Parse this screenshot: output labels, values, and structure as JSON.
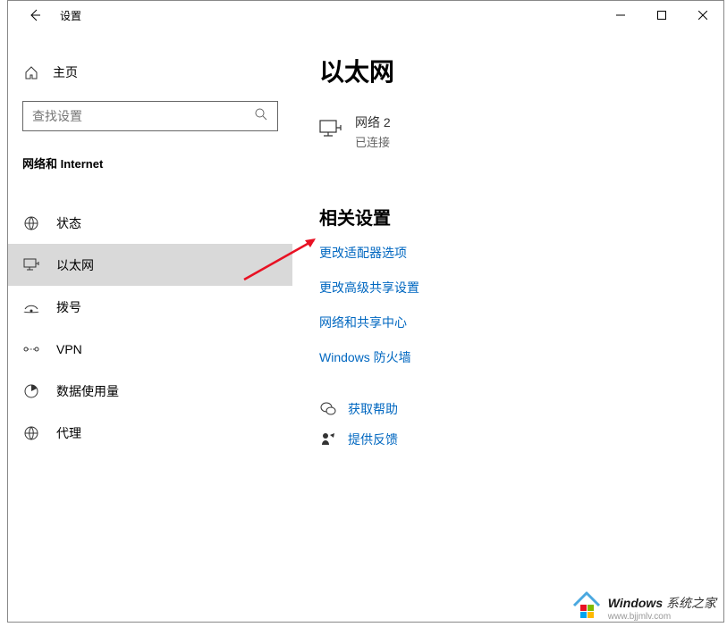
{
  "titlebar": {
    "title": "设置"
  },
  "sidebar": {
    "home_label": "主页",
    "search_placeholder": "查找设置",
    "section_header": "网络和 Internet",
    "items": [
      {
        "label": "状态"
      },
      {
        "label": "以太网"
      },
      {
        "label": "拨号"
      },
      {
        "label": "VPN"
      },
      {
        "label": "数据使用量"
      },
      {
        "label": "代理"
      }
    ]
  },
  "main": {
    "page_title": "以太网",
    "network": {
      "name": "网络 2",
      "status": "已连接"
    },
    "related": {
      "title": "相关设置",
      "links": [
        "更改适配器选项",
        "更改高级共享设置",
        "网络和共享中心",
        "Windows 防火墙"
      ]
    },
    "help_label": "获取帮助",
    "feedback_label": "提供反馈"
  },
  "watermark": {
    "bold": "Windows",
    "text": " 系统之家",
    "url": "www.bjjmlv.com"
  }
}
